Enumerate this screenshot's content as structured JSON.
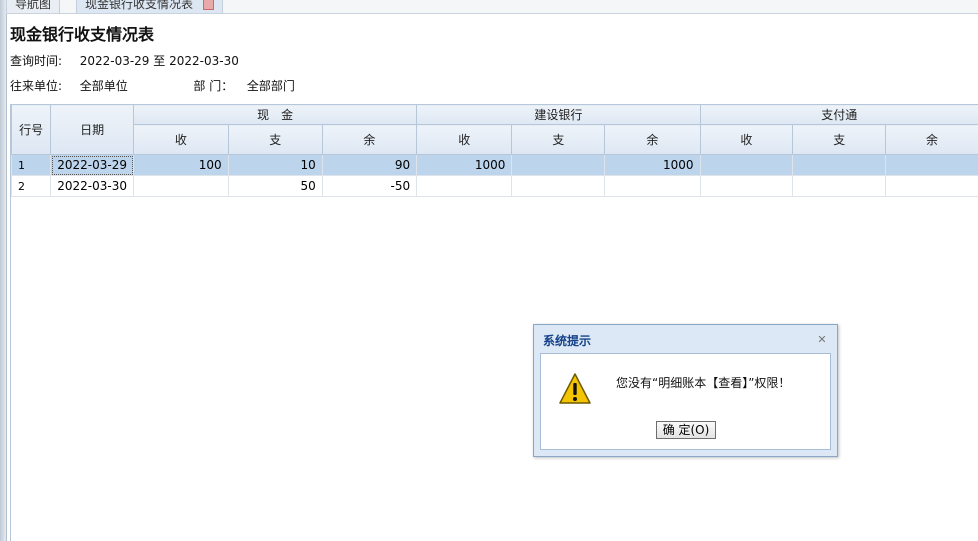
{
  "tabs": [
    {
      "label": "导航图",
      "active": false
    },
    {
      "label": "现金银行收支情况表",
      "active": true
    }
  ],
  "report": {
    "title": "现金银行收支情况表",
    "time_label": "查询时间:",
    "time_from": "2022-03-29",
    "time_sep": "至",
    "time_to": "2022-03-30",
    "unit_label": "往来单位:",
    "unit_value": "全部单位",
    "dept_label": "部 门：",
    "dept_value": "全部部门"
  },
  "table": {
    "rownum_header": "行号",
    "date_header": "日期",
    "groups": [
      {
        "name": "现　金",
        "cols": [
          "收",
          "支",
          "余"
        ]
      },
      {
        "name": "建设银行",
        "cols": [
          "收",
          "支",
          "余"
        ]
      },
      {
        "name": "支付通",
        "cols": [
          "收",
          "支",
          "余"
        ]
      }
    ],
    "rows": [
      {
        "rownum": "1",
        "date": "2022-03-29",
        "cells": [
          "100",
          "10",
          "90",
          "1000",
          "",
          "1000",
          "",
          "",
          ""
        ],
        "selected": true
      },
      {
        "rownum": "2",
        "date": "2022-03-30",
        "cells": [
          "",
          "50",
          "-50",
          "",
          "",
          "",
          "",
          "",
          ""
        ],
        "selected": false
      }
    ]
  },
  "dialog": {
    "title": "系统提示",
    "message": "您没有“明细账本【查看】”权限！",
    "ok_label": "确 定(O)",
    "icon": "warning-icon",
    "close_icon": "close-icon"
  },
  "colors": {
    "accent": "#15428b",
    "header_bg": "#dde7f3",
    "selected_row": "#bcd4ec",
    "dialog_bg": "#dce8f5"
  }
}
